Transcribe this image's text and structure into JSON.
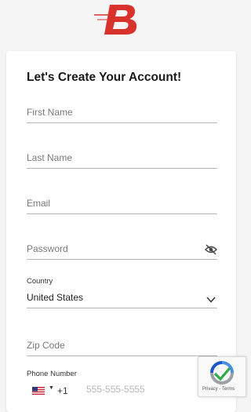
{
  "brand": {
    "logo_letter": "B",
    "color": "#d9312b"
  },
  "form": {
    "title": "Let's Create Your Account!",
    "first_name": {
      "placeholder": "First Name",
      "value": ""
    },
    "last_name": {
      "placeholder": "Last Name",
      "value": ""
    },
    "email": {
      "placeholder": "Email",
      "value": ""
    },
    "password": {
      "placeholder": "Password",
      "value": "",
      "visibility_icon": "eye-off-icon"
    },
    "country": {
      "label": "Country",
      "selected": "United States",
      "icon": "chevron-down-icon"
    },
    "zip": {
      "placeholder": "Zip Code",
      "value": ""
    },
    "phone": {
      "label": "Phone Number",
      "flag": "us-flag-icon",
      "dial_code": "+1",
      "placeholder": "555-555-5555",
      "value": ""
    }
  },
  "recaptcha": {
    "links": "Privacy - Terms"
  }
}
